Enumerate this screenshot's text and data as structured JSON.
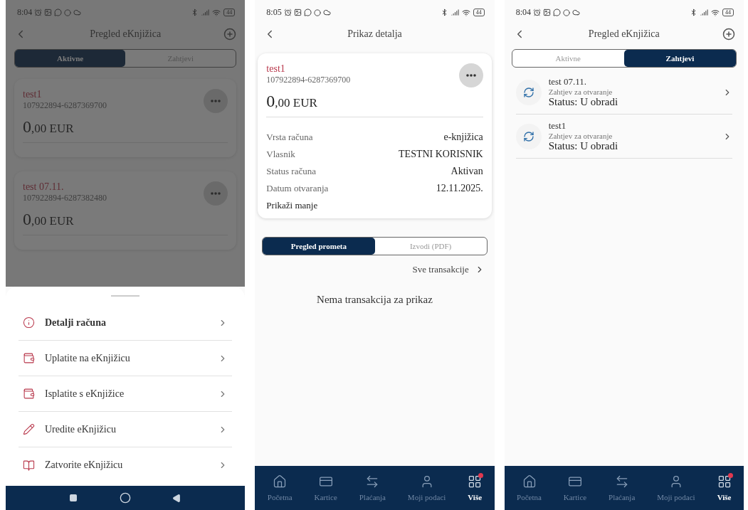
{
  "screens": [
    {
      "kind": "account_list",
      "dimmed": true,
      "status_bar": {
        "time": "8:04",
        "battery": "44"
      },
      "header": {
        "title": "Pregled eKnjižica",
        "add_button": true
      },
      "tabs": [
        {
          "label": "Aktivne",
          "selected": true
        },
        {
          "label": "Zahtjevi",
          "selected": false
        }
      ],
      "accounts": [
        {
          "name": "test1",
          "number": "107922894-6287369700",
          "amount_major": "0",
          "amount_minor": ",00 EUR"
        },
        {
          "name": "test 07.11.",
          "number": "107922894-6287382480",
          "amount_major": "0",
          "amount_minor": ",00 EUR"
        }
      ],
      "sheet": {
        "items": [
          {
            "kind": "info",
            "label": "Detalji računa",
            "bold": true
          },
          {
            "kind": "deposit",
            "label": "Uplatite na eKnjižicu",
            "bold": false
          },
          {
            "kind": "withdraw",
            "label": "Isplatite s eKnjižice",
            "bold": false
          },
          {
            "kind": "edit",
            "label": "Uredite eKnjižicu",
            "bold": false
          },
          {
            "kind": "close",
            "label": "Zatvorite eKnjižicu",
            "bold": false
          }
        ]
      },
      "system_nav": true
    },
    {
      "kind": "account_detail",
      "status_bar": {
        "time": "8:05",
        "battery": "44"
      },
      "header": {
        "title": "Prikaz detalja",
        "add_button": false
      },
      "account": {
        "name": "test1",
        "number": "107922894-6287369700",
        "amount_major": "0",
        "amount_minor": ",00 EUR"
      },
      "details": [
        {
          "label": "Vrsta računa",
          "value": "e-knjižica"
        },
        {
          "label": "Vlasnik",
          "value": "TESTNI KORISNIK"
        },
        {
          "label": "Status računa",
          "value": "Aktivan"
        },
        {
          "label": "Datum otvaranja",
          "value": "12.11.2025."
        }
      ],
      "toggle": "Prikaži manje",
      "tabs": [
        {
          "label": "Pregled prometa",
          "selected": true
        },
        {
          "label": "Izvodi (PDF)",
          "selected": false
        }
      ],
      "link": "Sve transakcije",
      "empty": "Nema transakcija za prikaz",
      "nav": [
        {
          "kind": "home",
          "label": "Početna",
          "selected": false,
          "badge": false
        },
        {
          "kind": "card",
          "label": "Kartice",
          "selected": false,
          "badge": false
        },
        {
          "kind": "transfer",
          "label": "Plaćanja",
          "selected": false,
          "badge": false
        },
        {
          "kind": "user",
          "label": "Moji podaci",
          "selected": false,
          "badge": false
        },
        {
          "kind": "grid",
          "label": "Više",
          "selected": true,
          "badge": true
        }
      ]
    },
    {
      "kind": "requests",
      "status_bar": {
        "time": "8:04",
        "battery": "44"
      },
      "header": {
        "title": "Pregled eKnjižica",
        "add_button": true
      },
      "tabs": [
        {
          "label": "Aktivne",
          "selected": false
        },
        {
          "label": "Zahtjevi",
          "selected": true
        }
      ],
      "requests": [
        {
          "name": "test 07.11.",
          "type": "Zahtjev za otvaranje",
          "status": "Status: U obradi"
        },
        {
          "name": "test1",
          "type": "Zahtjev za otvaranje",
          "status": "Status: U obradi"
        }
      ],
      "nav": [
        {
          "kind": "home",
          "label": "Početna",
          "selected": false,
          "badge": false
        },
        {
          "kind": "card",
          "label": "Kartice",
          "selected": false,
          "badge": false
        },
        {
          "kind": "transfer",
          "label": "Plaćanja",
          "selected": false,
          "badge": false
        },
        {
          "kind": "user",
          "label": "Moji podaci",
          "selected": false,
          "badge": false
        },
        {
          "kind": "grid",
          "label": "Više",
          "selected": true,
          "badge": true
        }
      ]
    }
  ]
}
